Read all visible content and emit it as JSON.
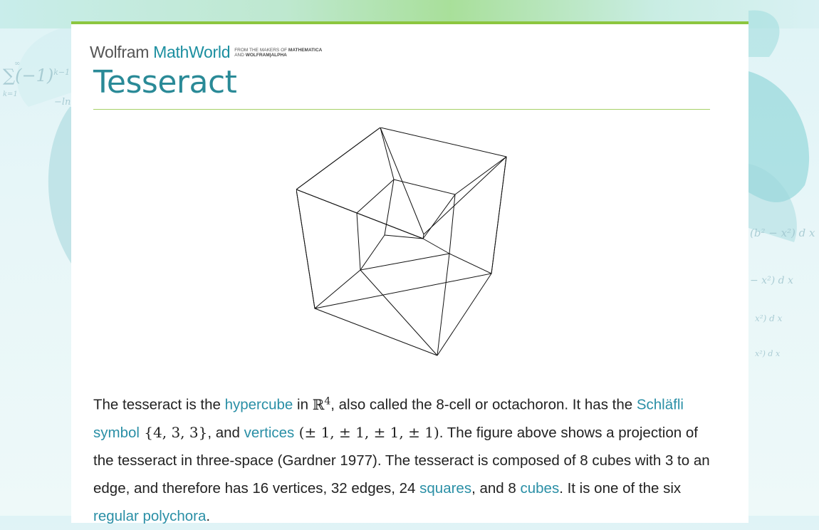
{
  "header": {
    "brand_wolfram": "Wolfram",
    "brand_mathworld": "MathWorld",
    "brand_tag_line1": "FROM THE MAKERS OF",
    "brand_tag_line1_bold": "MATHEMATICA",
    "brand_tag_line2": "AND",
    "brand_tag_line2_bold": "WOLFRAM|ALPHA"
  },
  "page": {
    "title": "Tesseract"
  },
  "background": {
    "formula_sum": "∑(−1)",
    "formula_exp": "k−1",
    "formula_sub": "k=1",
    "formula_top": "∞",
    "formula_ln": "−ln",
    "formula_dx1": "(b² − x²)  d x",
    "formula_dx2": "− x²)  d x",
    "formula_dx3": "x²)  d x",
    "formula_dx4": "x²)  d x"
  },
  "article": {
    "p1_a": "The tesseract is the ",
    "link_hypercube": "hypercube",
    "p1_b": " in ",
    "math_R": "ℝ",
    "math_R_exp": "4",
    "p1_c": ", also called the 8-cell or octachoron. It has the ",
    "link_schlafli": "Schläfli symbol",
    "math_symbol": " {4, 3, 3}",
    "p1_d": ", and ",
    "link_vertices": "vertices",
    "math_vertices": " (± 1, ± 1, ± 1, ± 1)",
    "p1_e": ". The figure above shows a projection of the tesseract in three-space (Gardner 1977). The tesseract is composed of 8 cubes with 3 to an edge, and therefore has 16 vertices, 32 edges, 24 ",
    "link_squares": "squares",
    "p1_f": ", and 8 ",
    "link_cubes": "cubes",
    "p1_g": ". It is one of the six ",
    "link_polychora": "regular polychora",
    "p1_h": "."
  },
  "colors": {
    "accent_green": "#8cc63f",
    "title_teal": "#2a8a97",
    "link_teal": "#2a8fa6"
  }
}
